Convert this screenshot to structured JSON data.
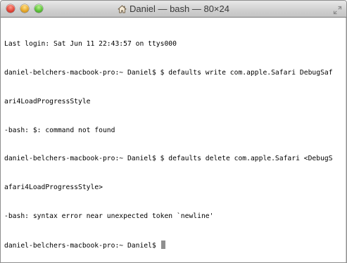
{
  "window": {
    "title": "Daniel — bash — 80×24"
  },
  "terminal": {
    "lines": [
      "Last login: Sat Jun 11 22:43:57 on ttys000",
      "daniel-belchers-macbook-pro:~ Daniel$ $ defaults write com.apple.Safari DebugSaf",
      "ari4LoadProgressStyle",
      "-bash: $: command not found",
      "daniel-belchers-macbook-pro:~ Daniel$ $ defaults delete com.apple.Safari <DebugS",
      "afari4LoadProgressStyle>",
      "-bash: syntax error near unexpected token `newline'",
      "daniel-belchers-macbook-pro:~ Daniel$ "
    ]
  },
  "icons": {
    "close": "close-button",
    "minimize": "minimize-button",
    "zoom": "zoom-button",
    "home": "home-icon",
    "fullscreen": "fullscreen-icon"
  },
  "colors": {
    "close": "#e1483b",
    "minimize": "#e6a82a",
    "zoom": "#5cc23a",
    "cursor": "#8f8f8f"
  }
}
